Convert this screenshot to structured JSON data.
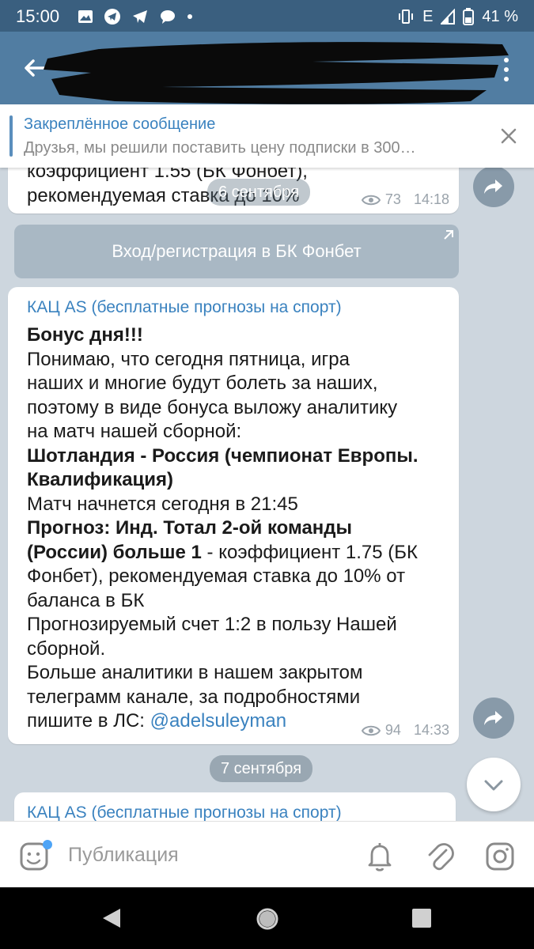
{
  "status_bar": {
    "time": "15:00",
    "network": "E",
    "battery": "41 %"
  },
  "header": {
    "back_icon": "arrow-left-icon",
    "more_icon": "more-vertical-icon"
  },
  "pinned": {
    "title": "Закреплённое сообщение",
    "text": "Друзья, мы решили поставить цену подписки в 300…"
  },
  "messages": [
    {
      "partial_lines": [
        "коэффициент 1.55 (БК Фонбет),",
        "рекомендуемая ставка до 10%"
      ],
      "floating_date": "6 сентября",
      "views": "73",
      "time": "14:18",
      "inline_button": "Вход/регистрация в БК Фонбет"
    },
    {
      "channel": "КАЦ AS (бесплатные прогнозы на спорт)",
      "lines": [
        "Бонус дня!!!",
        "Понимаю, что сегодня пятница, игра",
        "наших и многие будут болеть за наших,",
        "поэтому в виде бонуса выложу аналитику",
        "на матч нашей сборной:",
        "Шотландия - Россия (чемпионат Европы.",
        "Квалификация)",
        "Матч начнется сегодня в 21:45",
        "Прогноз: Инд. Тотал 2-ой команды",
        "(России) больше 1",
        " - коэффициент 1.75 (БК",
        "Фонбет), рекомендуемая ставка до 10% от",
        "баланса в БК",
        "Прогнозируемый счет 1:2 в пользу Нашей",
        "сборной.",
        "Больше аналитики в нашем закрытом",
        "телеграмм канале, за подробностями",
        "пишите в ЛС: ",
        "@adelsuleyman"
      ],
      "views": "94",
      "time": "14:33"
    }
  ],
  "date_separator": "7 сентября",
  "next_message_channel": "КАЦ AS (бесплатные прогнозы на спорт)",
  "input": {
    "placeholder": "Публикация"
  },
  "colors": {
    "header": "#517da2",
    "status_bar": "#3a5f7f",
    "accent": "#3a82bf",
    "chat_bg": "#cdd6de"
  }
}
